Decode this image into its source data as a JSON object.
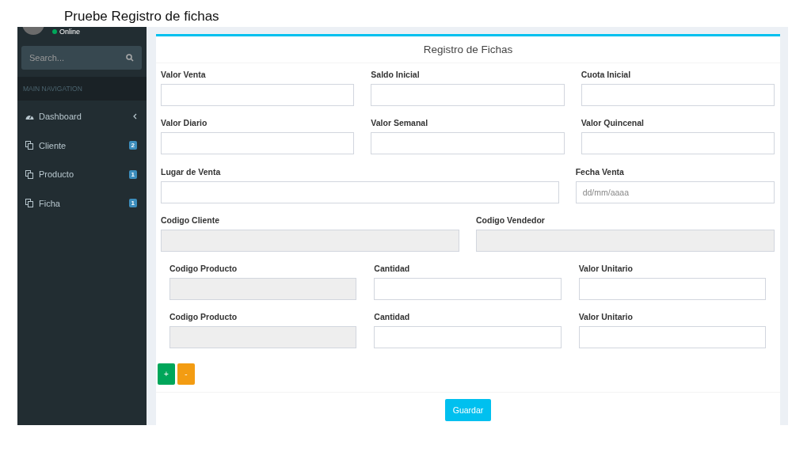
{
  "slide_title": "Pruebe Registro de fichas",
  "sidebar": {
    "user_status": "Online",
    "search": {
      "placeholder": "Search..."
    },
    "section_header": "MAIN NAVIGATION",
    "items": [
      {
        "kind": "dashboard",
        "label": "Dashboard",
        "expandable": true
      },
      {
        "kind": "page",
        "label": "Cliente",
        "badge": "2",
        "expandable": false
      },
      {
        "kind": "page",
        "label": "Producto",
        "badge": "1",
        "expandable": false
      },
      {
        "kind": "page",
        "label": "Ficha",
        "badge": "1",
        "expandable": false
      }
    ]
  },
  "form": {
    "title": "Registro de Fichas",
    "rows": [
      {
        "kind": "thirds",
        "fields": [
          {
            "label": "Valor Venta",
            "disabled": false
          },
          {
            "label": "Saldo Inicial",
            "disabled": false
          },
          {
            "label": "Cuota Inicial",
            "disabled": false
          }
        ]
      },
      {
        "kind": "thirds",
        "fields": [
          {
            "label": "Valor Diario",
            "disabled": false
          },
          {
            "label": "Valor Semanal",
            "disabled": false
          },
          {
            "label": "Valor Quincenal",
            "disabled": false
          }
        ]
      },
      {
        "kind": "wide_left",
        "fields": [
          {
            "label": "Lugar de Venta",
            "disabled": false
          },
          {
            "label": "Fecha Venta",
            "disabled": false,
            "placeholder": "dd/mm/aaaa"
          }
        ]
      },
      {
        "kind": "halves",
        "fields": [
          {
            "label": "Codigo Cliente",
            "disabled": true
          },
          {
            "label": "Codigo Vendedor",
            "disabled": true
          }
        ]
      },
      {
        "kind": "product",
        "fields": [
          {
            "label": "Codigo Producto",
            "disabled": true
          },
          {
            "label": "Cantidad",
            "disabled": false
          },
          {
            "label": "Valor Unitario",
            "disabled": false
          }
        ]
      },
      {
        "kind": "product",
        "fields": [
          {
            "label": "Codigo Producto",
            "disabled": true
          },
          {
            "label": "Cantidad",
            "disabled": false
          },
          {
            "label": "Valor Unitario",
            "disabled": false
          }
        ]
      }
    ],
    "add_button": "+",
    "remove_button": "-",
    "submit_button": "Guardar"
  }
}
